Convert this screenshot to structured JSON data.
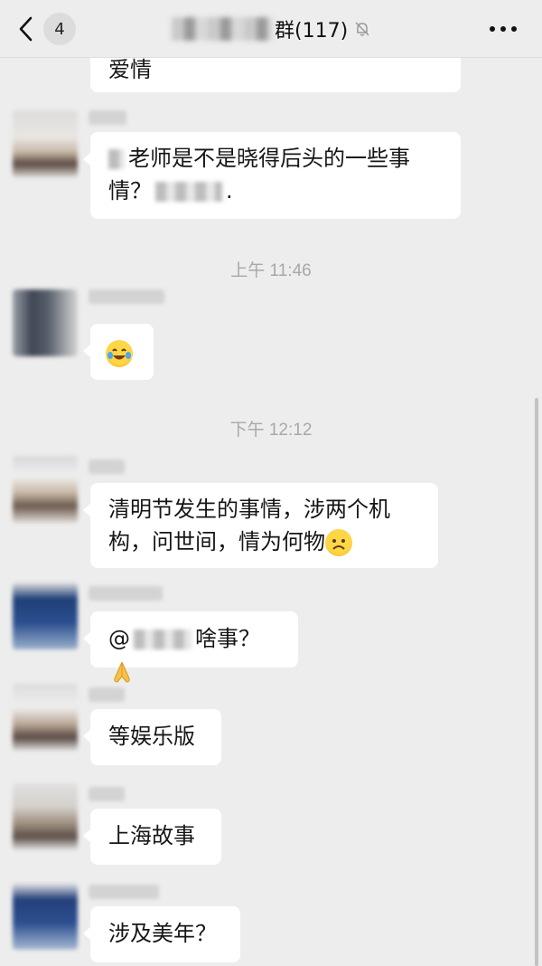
{
  "header": {
    "unread_count": "4",
    "title_suffix": "群(117)",
    "back_icon": "chevron-left-icon",
    "mute_icon": "bell-slash-icon",
    "more_icon": "more-dots-icon"
  },
  "messages": [
    {
      "id": "m0",
      "text": "爱情"
    },
    {
      "id": "m1",
      "text_before": "老师是不是晓得后头的一些事情？",
      "text_after": "."
    },
    {
      "id": "t1",
      "time": "上午 11:46"
    },
    {
      "id": "m2",
      "emoji": "laughing-tears-emoji"
    },
    {
      "id": "t2",
      "time": "下午 12:12"
    },
    {
      "id": "m3",
      "text": "清明节发生的事情，涉两个机构，问世间，情为何物",
      "emoji": "worried-face-emoji"
    },
    {
      "id": "m4",
      "text_before": "@",
      "text_after": "啥事？",
      "emoji": "folded-hands-emoji"
    },
    {
      "id": "m5",
      "text": "等娱乐版"
    },
    {
      "id": "m6",
      "text": "上海故事"
    },
    {
      "id": "m7",
      "text": "涉及美年？"
    }
  ],
  "colors": {
    "background": "#ededed",
    "bubble": "#ffffff",
    "time_text": "#a8a8a8"
  }
}
